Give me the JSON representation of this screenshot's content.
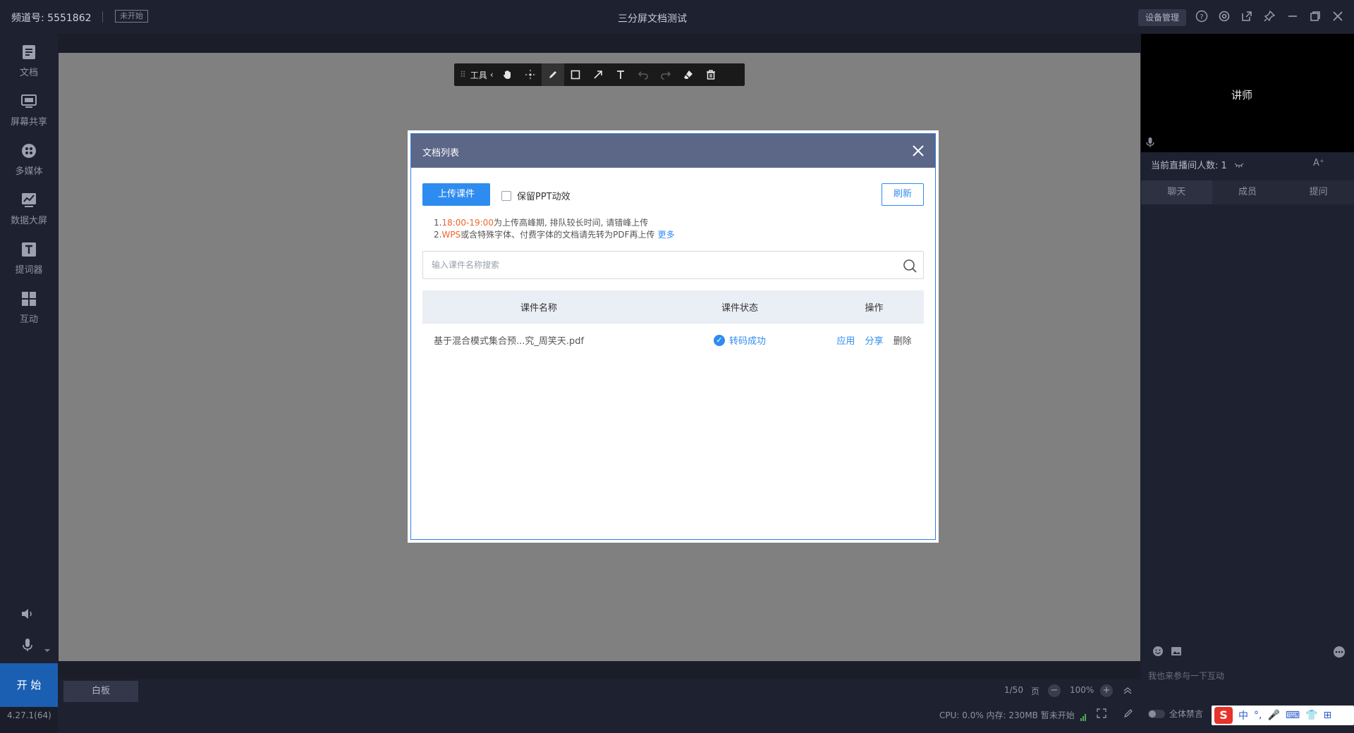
{
  "header": {
    "channel_label": "频道号: 5551862",
    "status_badge": "未开始",
    "title": "三分屏文档测试",
    "device_mgmt": "设备管理",
    "icons": [
      "help-icon",
      "settings-icon",
      "popout-icon",
      "pin-icon",
      "minimize-icon",
      "maximize-icon",
      "close-icon"
    ]
  },
  "sidebar": {
    "items": [
      {
        "label": "文档",
        "icon": "document-icon"
      },
      {
        "label": "屏幕共享",
        "icon": "screen-share-icon"
      },
      {
        "label": "多媒体",
        "icon": "multimedia-icon"
      },
      {
        "label": "数据大屏",
        "icon": "data-screen-icon"
      },
      {
        "label": "提词器",
        "icon": "teleprompter-icon"
      },
      {
        "label": "互动",
        "icon": "interaction-icon"
      }
    ],
    "start_label": "开 始",
    "version": "4.27.1(64)"
  },
  "toolbar": {
    "label": "工具",
    "tools": [
      "hand-icon",
      "laser-icon",
      "pen-icon",
      "rectangle-icon",
      "arrow-icon",
      "text-icon",
      "undo-icon",
      "redo-icon",
      "eraser-icon",
      "trash-icon"
    ]
  },
  "bottom": {
    "whiteboard_label": "白板",
    "page": "1/50",
    "page_unit": "页",
    "zoom": "100%",
    "sys_info": "CPU: 0.0%  内存: 230MB  暂未开始"
  },
  "right_panel": {
    "video_label": "讲师",
    "viewers": "当前直播间人数: 1",
    "font_btn": "A⁺",
    "tabs": [
      "聊天",
      "成员",
      "提问"
    ],
    "chat_placeholder": "我也来参与一下互动",
    "mute_all": "全体禁言"
  },
  "ime": {
    "logo": "S",
    "items": [
      "中",
      "°,",
      "🎤",
      "⌨",
      "👕",
      "⊞"
    ]
  },
  "dialog": {
    "title": "文档列表",
    "upload_label": "上传课件",
    "ppt_anim_label": "保留PPT动效",
    "ppt_anim_checked": false,
    "refresh_label": "刷新",
    "note1_prefix": "1.",
    "note1_highlight": "18:00-19:00",
    "note1_rest": "为上传高峰期, 排队较长时间, 请错峰上传",
    "note2_prefix": "2.",
    "note2_highlight": "WPS",
    "note2_rest": "或含特殊字体、付费字体的文档请先转为PDF再上传",
    "note2_more": "更多",
    "search_placeholder": "输入课件名称搜索",
    "columns": {
      "name": "课件名称",
      "status": "课件状态",
      "op": "操作"
    },
    "rows": [
      {
        "name": "基于混合模式集合预...究_周笑天.pdf",
        "status": "转码成功",
        "apply": "应用",
        "share": "分享",
        "delete": "删除"
      }
    ]
  }
}
